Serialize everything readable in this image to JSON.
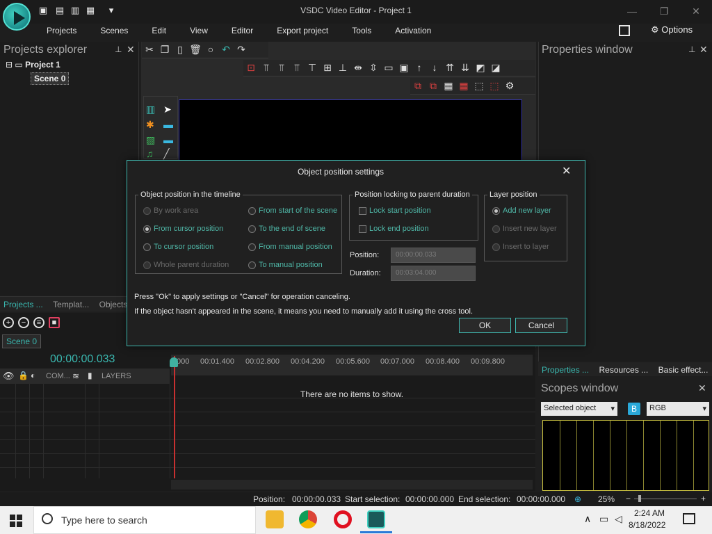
{
  "window": {
    "title": "VSDC Video Editor - Project 1",
    "options_label": "Options",
    "minimize": "—",
    "maximize": "❐",
    "close": "✕"
  },
  "menu": [
    "Projects",
    "Scenes",
    "Edit",
    "View",
    "Editor",
    "Export project",
    "Tools",
    "Activation"
  ],
  "projects_explorer": {
    "title": "Projects explorer",
    "tree_root": "Project 1",
    "tree_child": "Scene 0",
    "bottom_tabs": [
      "Projects ...",
      "Templat...",
      "Objects"
    ]
  },
  "properties_window": {
    "title": "Properties window",
    "tabs": [
      "Properties ...",
      "Resources ...",
      "Basic effect..."
    ]
  },
  "scopes": {
    "title": "Scopes window",
    "source": "Selected object",
    "b_badge": "B",
    "mode": "RGB"
  },
  "timeline": {
    "scene_tab": "Scene 0",
    "current_time": "00:00:00.033",
    "col_com": "COM...",
    "col_layers": "LAYERS",
    "ruler_ticks": [
      "000",
      "00:01.400",
      "00:02.800",
      "00:04.200",
      "00:05.600",
      "00:07.000",
      "00:08.400",
      "00:09.800"
    ],
    "empty_message": "There are no items to show."
  },
  "status": {
    "position_label": "Position:",
    "position_value": "00:00:00.033",
    "start_label": "Start selection:",
    "start_value": "00:00:00.000",
    "end_label": "End selection:",
    "end_value": "00:00:00.000",
    "zoom": "25%"
  },
  "taskbar": {
    "search_placeholder": "Type here to search",
    "time": "2:24 AM",
    "date": "8/18/2022"
  },
  "dialog": {
    "title": "Object position settings",
    "group_timeline": {
      "legend": "Object position in the timeline",
      "options": [
        {
          "label": "By work area",
          "enabled": false,
          "checked": false
        },
        {
          "label": "From start of the scene",
          "enabled": true,
          "checked": false
        },
        {
          "label": "From cursor position",
          "enabled": true,
          "checked": true
        },
        {
          "label": "To the end of scene",
          "enabled": true,
          "checked": false
        },
        {
          "label": "To cursor position",
          "enabled": true,
          "checked": false
        },
        {
          "label": "From manual position",
          "enabled": true,
          "checked": false
        },
        {
          "label": "Whole parent duration",
          "enabled": false,
          "checked": false
        },
        {
          "label": "To manual position",
          "enabled": true,
          "checked": false
        }
      ]
    },
    "group_locking": {
      "legend": "Position locking to parent duration",
      "lock_start": "Lock start position",
      "lock_end": "Lock end position"
    },
    "position_label": "Position:",
    "position_value": "00:00:00.033",
    "duration_label": "Duration:",
    "duration_value": "00:03:04.000",
    "group_layer": {
      "legend": "Layer position",
      "options": [
        {
          "label": "Add new layer",
          "enabled": true,
          "checked": true
        },
        {
          "label": "Insert new layer",
          "enabled": false,
          "checked": false
        },
        {
          "label": "Insert to layer",
          "enabled": false,
          "checked": false
        }
      ]
    },
    "note1": "Press \"Ok\" to apply settings or \"Cancel\" for operation canceling.",
    "note2": "If the object hasn't appeared in the scene, it means you need to manually add it using the cross tool.",
    "ok_label": "OK",
    "cancel_label": "Cancel"
  }
}
